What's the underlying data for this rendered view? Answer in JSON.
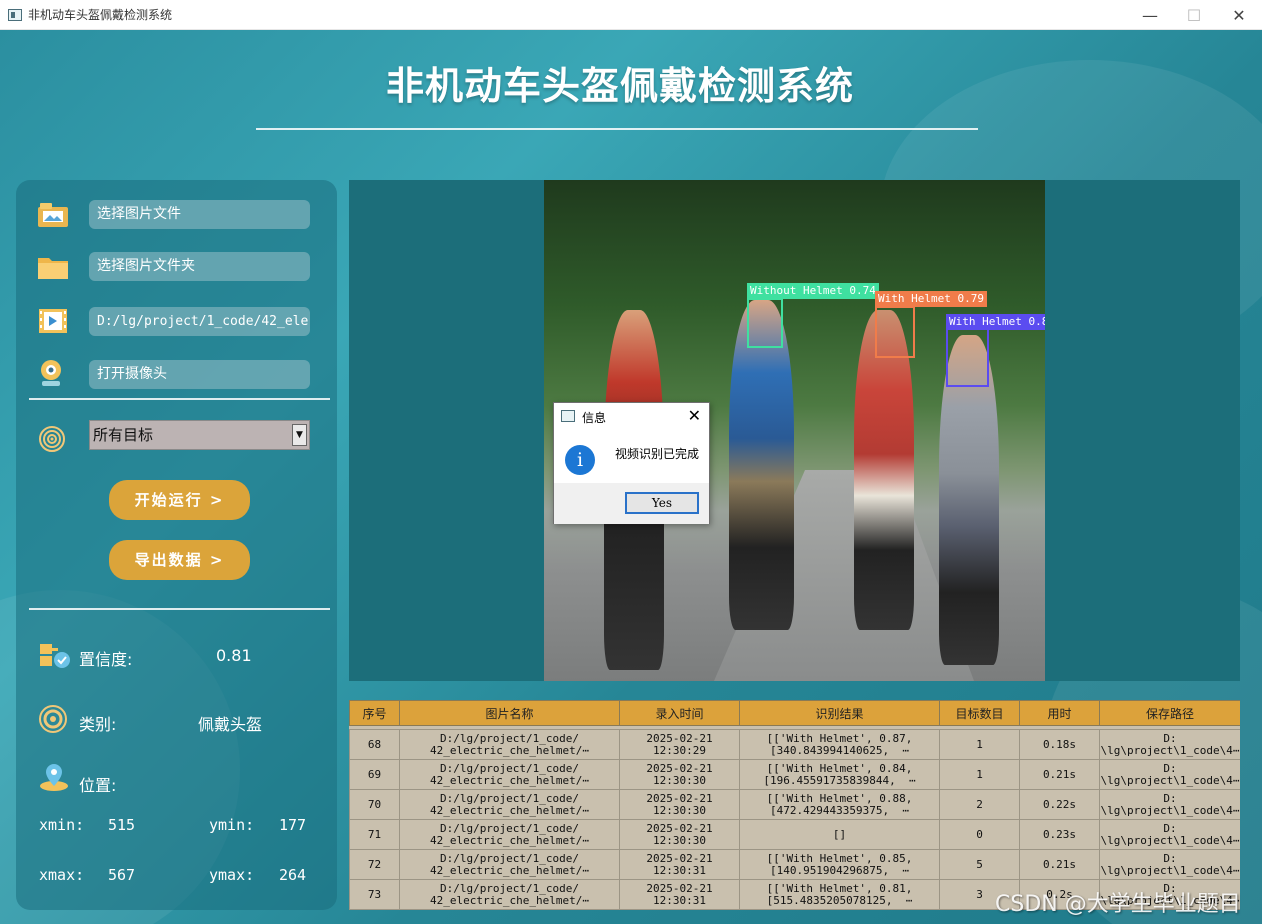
{
  "window": {
    "title": "非机动车头盔佩戴检测系统",
    "minimize": "—",
    "maximize": "☐",
    "close": "✕"
  },
  "header": {
    "title": "非机动车头盔佩戴检测系统"
  },
  "sidebar": {
    "select_image_label": "选择图片文件",
    "select_folder_label": "选择图片文件夹",
    "video_path": "D:/lg/project/1_code/42_ele",
    "open_camera_label": "打开摄像头",
    "target_select_value": "所有目标",
    "start_label": "开始运行 >",
    "export_label": "导出数据 >",
    "confidence": {
      "label": "置信度:",
      "value": "0.81"
    },
    "category": {
      "label": "类别:",
      "value": "佩戴头盔"
    },
    "position": {
      "label": "位置:",
      "xmin_label": "xmin:",
      "xmin": "515",
      "ymin_label": "ymin:",
      "ymin": "177",
      "xmax_label": "xmax:",
      "xmax": "567",
      "ymax_label": "ymax:",
      "ymax": "264"
    }
  },
  "detections": [
    {
      "label": "Without Helmet  0.74",
      "color": "#3fe0a0"
    },
    {
      "label": "With Helmet  0.79",
      "color": "#f07c4a"
    },
    {
      "label": "With Helmet  0.8",
      "color": "#5b4cf0"
    }
  ],
  "dialog": {
    "title": "信息",
    "message": "视频识别已完成",
    "ok_label": "Yes",
    "close": "✕",
    "info_glyph": "i"
  },
  "table": {
    "headers": [
      "序号",
      "图片名称",
      "录入时间",
      "识别结果",
      "目标数目",
      "用时",
      "保存路径"
    ],
    "rows": [
      [
        "68",
        "D:/lg/project/1_code/\n42_electric_che_helmet/⋯",
        "2025-02-21\n12:30:29",
        "[['With Helmet', 0.87,\n[340.843994140625,  ⋯",
        "1",
        "0.18s",
        "D:\n\\lg\\project\\1_code\\4⋯"
      ],
      [
        "69",
        "D:/lg/project/1_code/\n42_electric_che_helmet/⋯",
        "2025-02-21\n12:30:30",
        "[['With Helmet', 0.84,\n[196.45591735839844,  ⋯",
        "1",
        "0.21s",
        "D:\n\\lg\\project\\1_code\\4⋯"
      ],
      [
        "70",
        "D:/lg/project/1_code/\n42_electric_che_helmet/⋯",
        "2025-02-21\n12:30:30",
        "[['With Helmet', 0.88,\n[472.429443359375,  ⋯",
        "2",
        "0.22s",
        "D:\n\\lg\\project\\1_code\\4⋯"
      ],
      [
        "71",
        "D:/lg/project/1_code/\n42_electric_che_helmet/⋯",
        "2025-02-21\n12:30:30",
        "[]",
        "0",
        "0.23s",
        "D:\n\\lg\\project\\1_code\\4⋯"
      ],
      [
        "72",
        "D:/lg/project/1_code/\n42_electric_che_helmet/⋯",
        "2025-02-21\n12:30:31",
        "[['With Helmet', 0.85,\n[140.951904296875,  ⋯",
        "5",
        "0.21s",
        "D:\n\\lg\\project\\1_code\\4⋯"
      ],
      [
        "73",
        "D:/lg/project/1_code/\n42_electric_che_helmet/⋯",
        "2025-02-21\n12:30:31",
        "[['With Helmet', 0.81,\n[515.4835205078125,  ⋯",
        "3",
        "0.2s",
        "D:\n\\lg\\project\\1_code\\4⋯"
      ]
    ]
  },
  "watermark": "CSDN @大学生毕业题目"
}
